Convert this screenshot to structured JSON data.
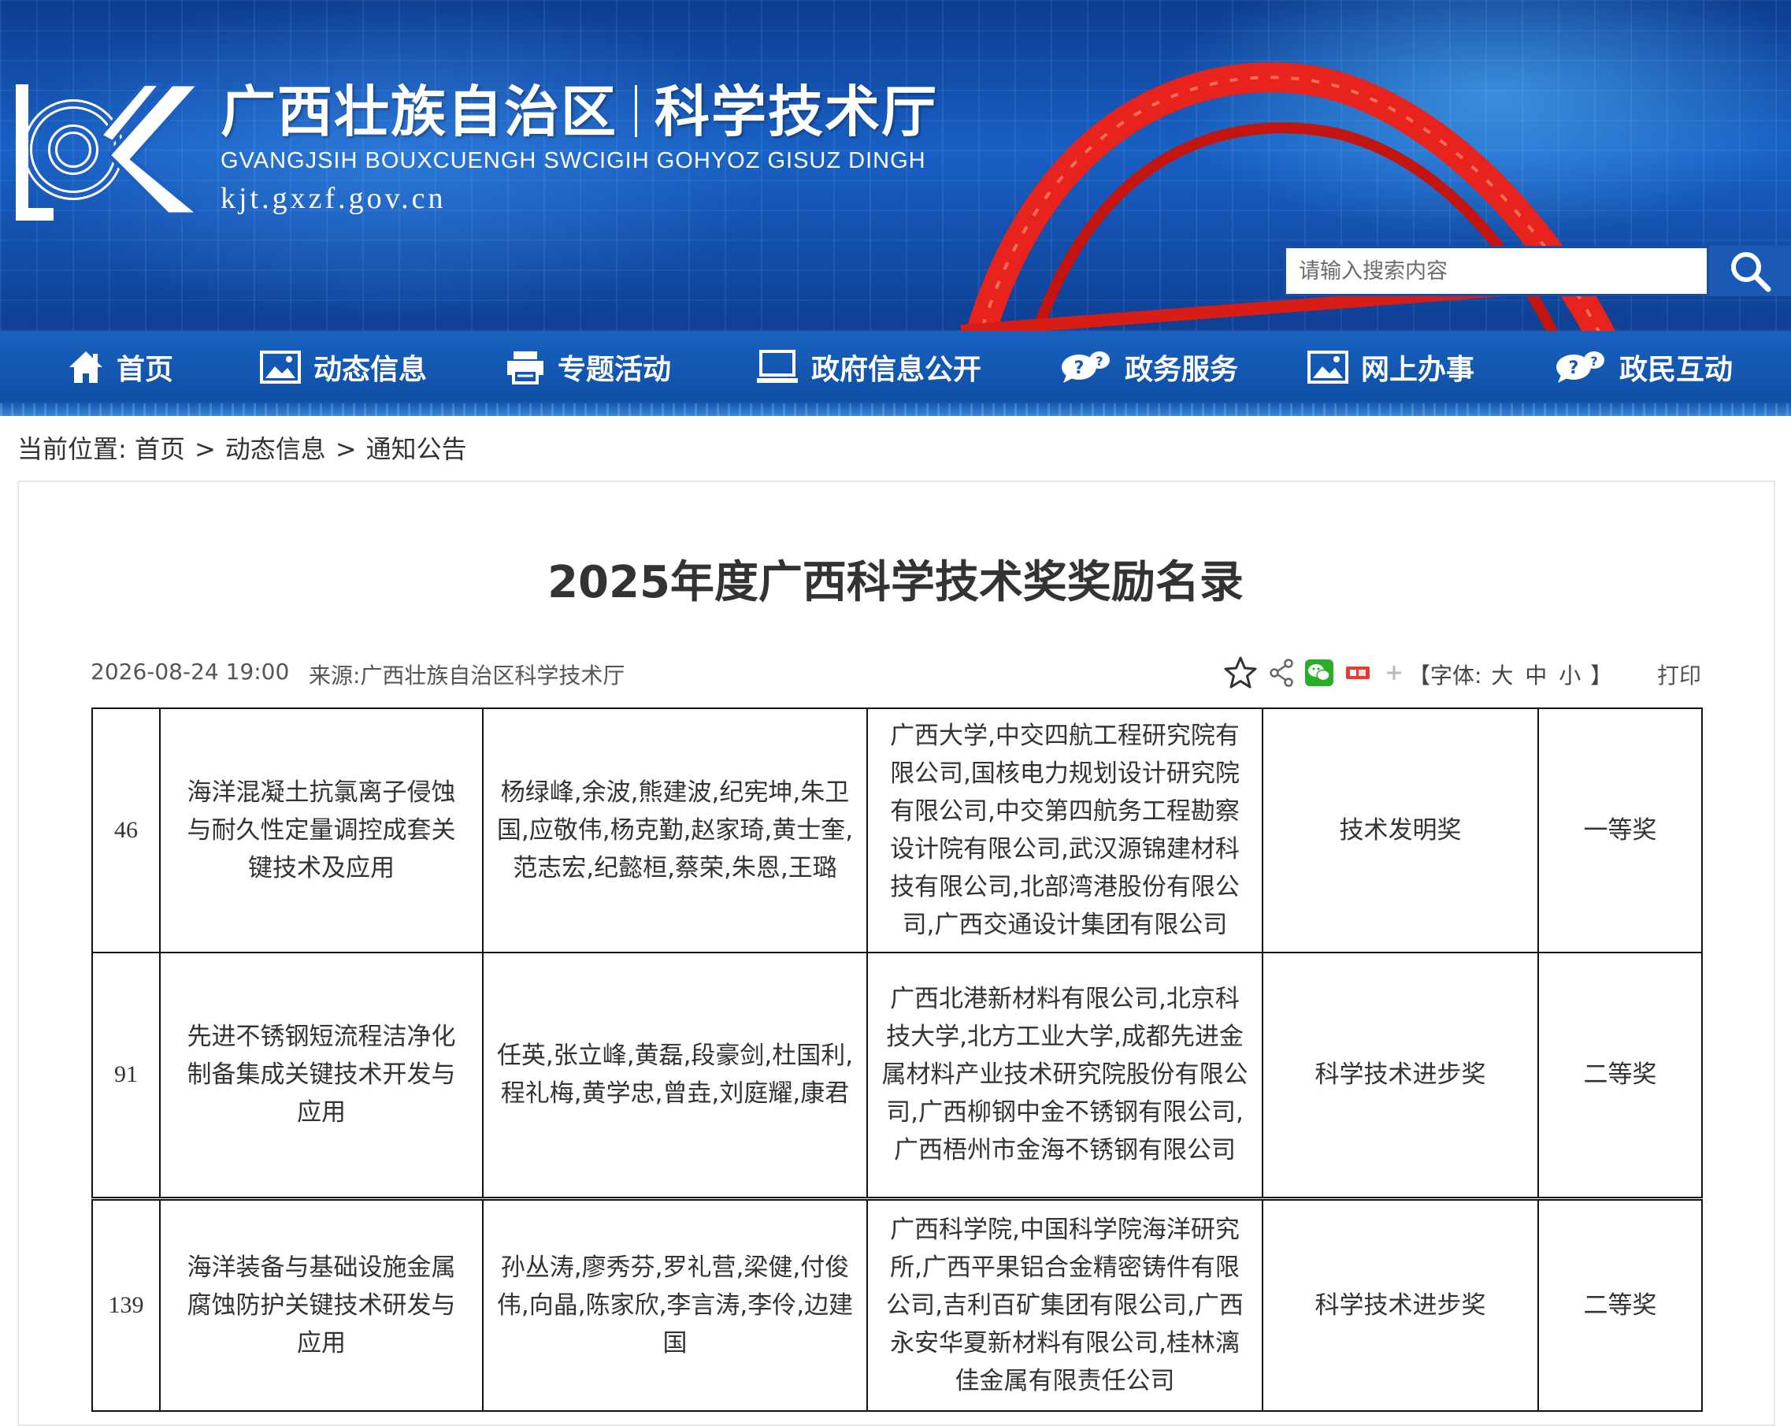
{
  "header": {
    "title_left": "广西壮族自治区",
    "title_right": "科学技术厅",
    "subtitle": "GVANGJSIH BOUXCUENGH SWCIGIH GOHYOZ GISUZ DINGH",
    "domain": "kjt.gxzf.gov.cn",
    "search": {
      "placeholder": "请输入搜索内容",
      "icon": "search-icon"
    }
  },
  "nav": [
    {
      "label": "首页",
      "icon": "home-icon"
    },
    {
      "label": "动态信息",
      "icon": "image-icon"
    },
    {
      "label": "专题活动",
      "icon": "printer-icon"
    },
    {
      "label": "政府信息公开",
      "icon": "monitor-icon"
    },
    {
      "label": "政务服务",
      "icon": "chat-question-icon"
    },
    {
      "label": "网上办事",
      "icon": "image-icon"
    },
    {
      "label": "政民互动",
      "icon": "chat-question-icon"
    }
  ],
  "breadcrumb": {
    "prefix": "当前位置:",
    "items": [
      "首页",
      "动态信息",
      "通知公告"
    ],
    "separator": ">"
  },
  "article": {
    "title": "2025年度广西科学技术奖奖励名录",
    "date": "2026-08-24 19:00",
    "source": "来源:广西壮族自治区科学技术厅",
    "tools": [
      "star-icon",
      "share-icon",
      "wechat-icon",
      "weibo-icon",
      "plus-icon"
    ],
    "font_prefix": "【字体:",
    "font_sizes": [
      "大",
      "中",
      "小"
    ],
    "font_suffix": "】",
    "print": "打印"
  },
  "table": {
    "rows": [
      {
        "num": "46",
        "project": "海洋混凝土抗氯离子侵蚀与耐久性定量调控成套关键技术及应用",
        "people": "杨绿峰,余波,熊建波,纪宪坤,朱卫国,应敬伟,杨克勤,赵家琦,黄士奎,范志宏,纪懿桓,蔡荣,朱恩,王璐",
        "units": "广西大学,中交四航工程研究院有限公司,国核电力规划设计研究院有限公司,中交第四航务工程勘察设计院有限公司,武汉源锦建材科技有限公司,北部湾港股份有限公司,广西交通设计集团有限公司",
        "category": "技术发明奖",
        "grade": "一等奖"
      },
      {
        "num": "91",
        "project": "先进不锈钢短流程洁净化制备集成关键技术开发与应用",
        "people": "任英,张立峰,黄磊,段豪剑,杜国利,程礼梅,黄学忠,曾垚,刘庭耀,康君",
        "units": "广西北港新材料有限公司,北京科技大学,北方工业大学,成都先进金属材料产业技术研究院股份有限公司,广西柳钢中金不锈钢有限公司,广西梧州市金海不锈钢有限公司",
        "category": "科学技术进步奖",
        "grade": "二等奖"
      },
      {
        "num": "139",
        "project": "海洋装备与基础设施金属腐蚀防护关键技术研发与应用",
        "people": "孙丛涛,廖秀芬,罗礼营,梁健,付俊伟,向晶,陈家欣,李言涛,李伶,边建国",
        "units": "广西科学院,中国科学院海洋研究所,广西平果铝合金精密铸件有限公司,吉利百矿集团有限公司,广西永安华夏新材料有限公司,桂林漓佳金属有限责任公司",
        "category": "科学技术进步奖",
        "grade": "二等奖"
      }
    ]
  }
}
